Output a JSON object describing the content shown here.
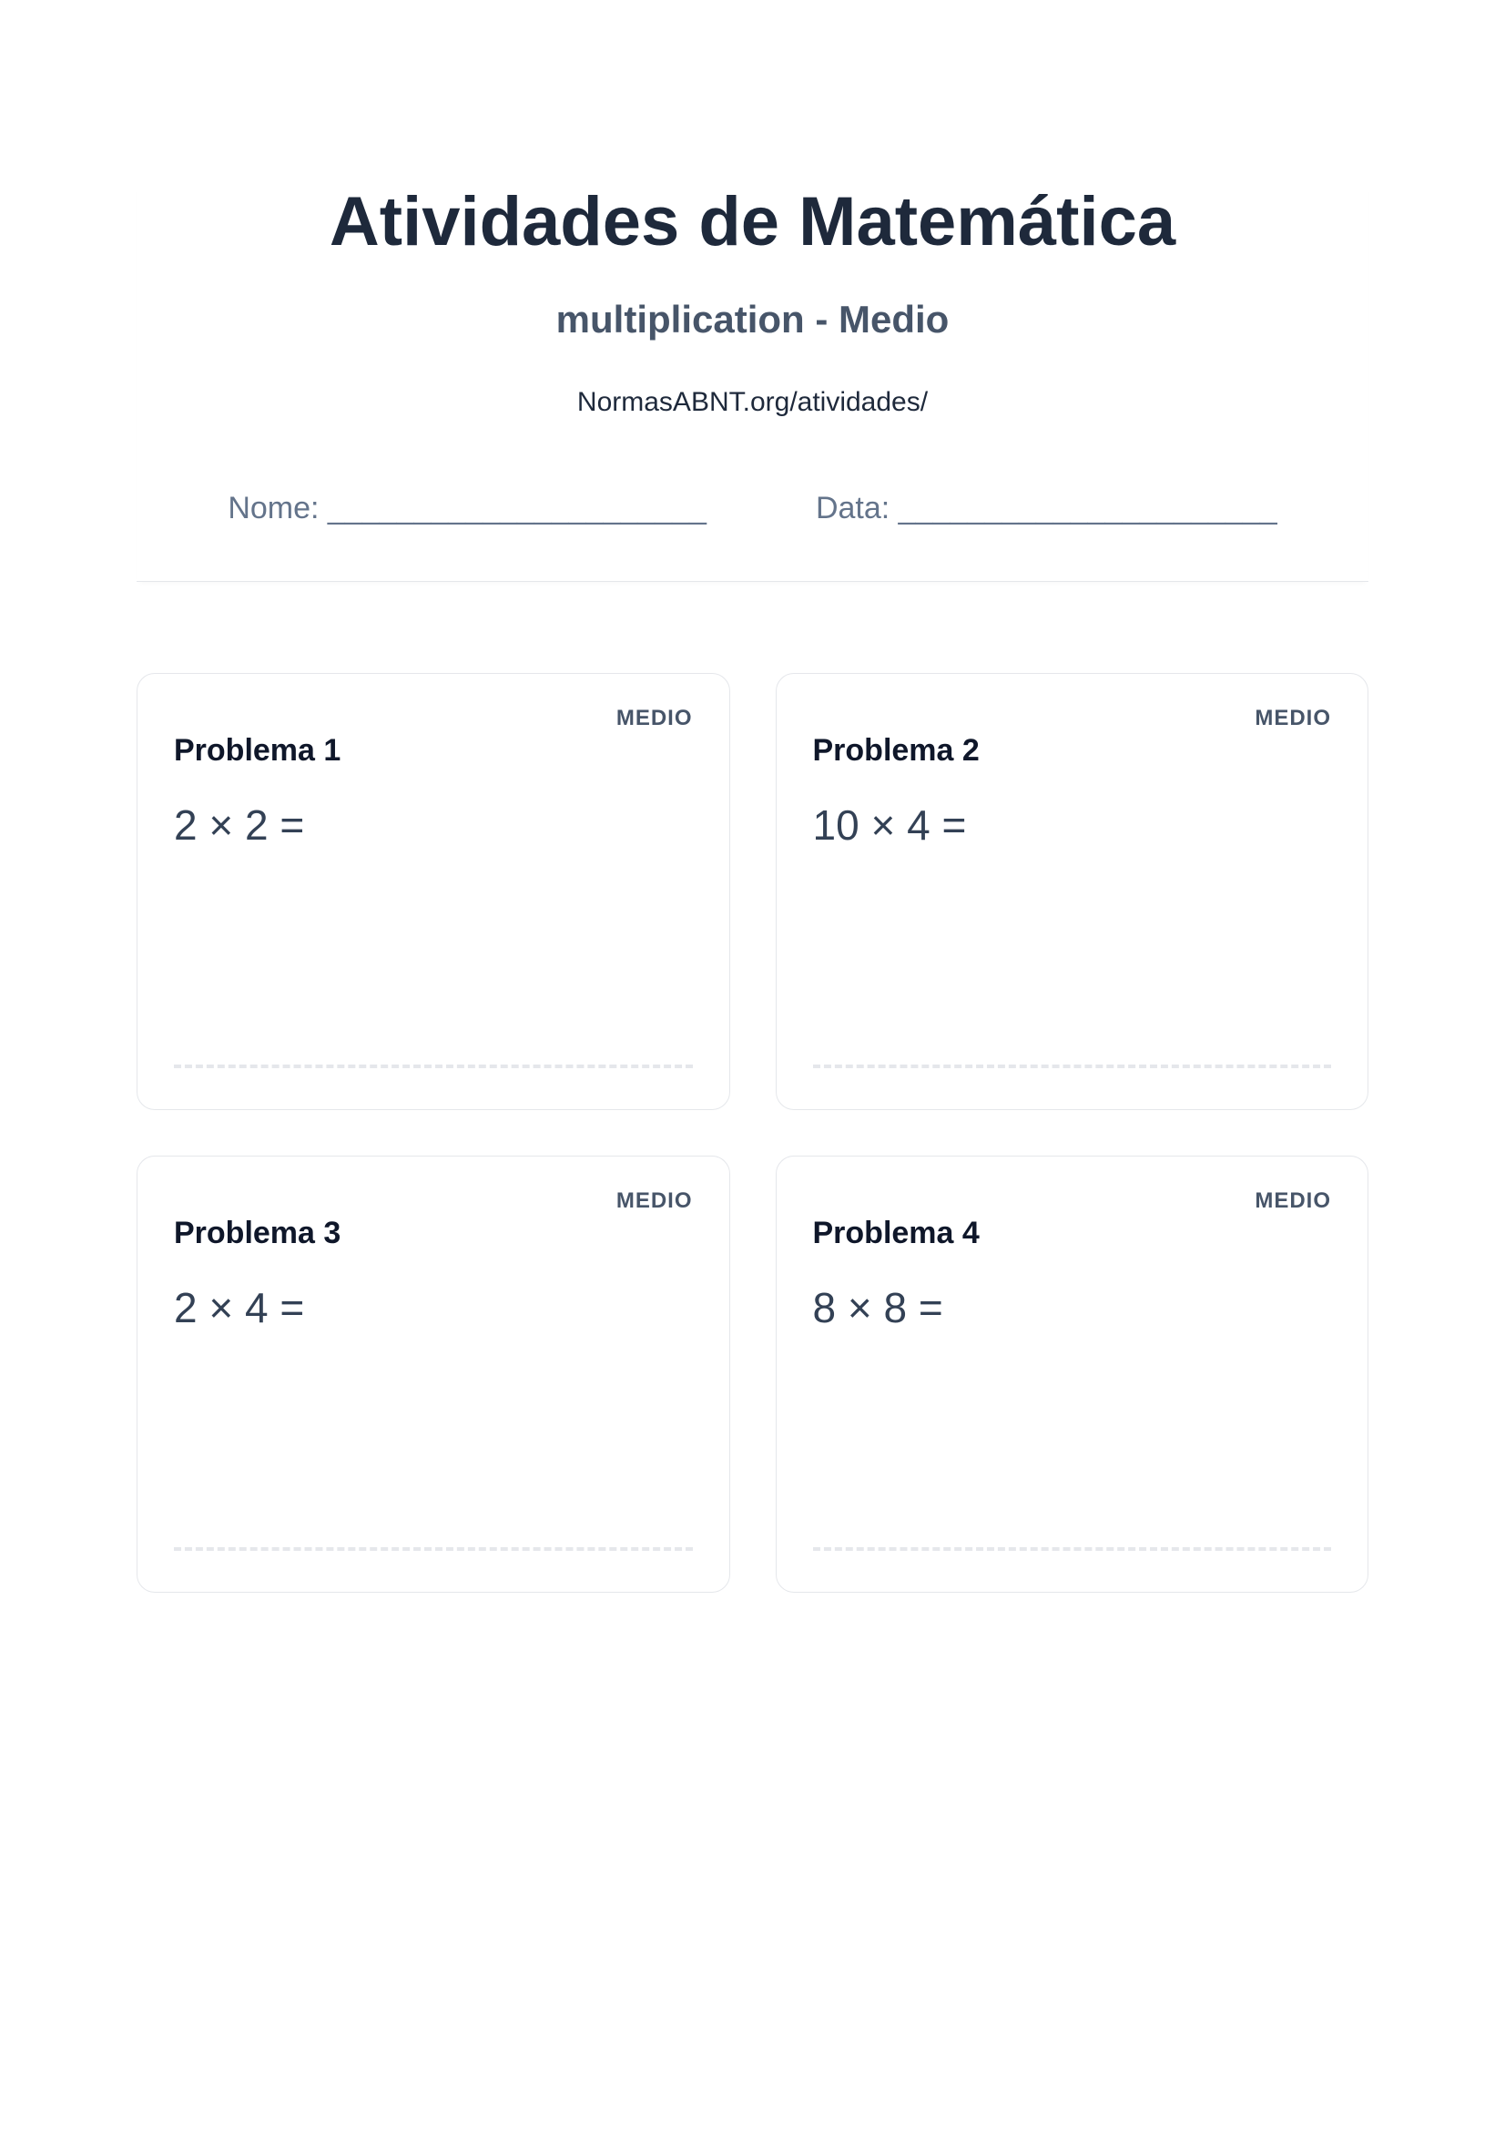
{
  "header": {
    "title": "Atividades de Matemática",
    "subtitle": "multiplication - Medio",
    "source": "NormasABNT.org/atividades/",
    "name_label": "Nome: ______________________",
    "date_label": "Data: ______________________"
  },
  "problems": [
    {
      "badge": "MEDIO",
      "title": "Problema 1",
      "expression": "2 × 2 ="
    },
    {
      "badge": "MEDIO",
      "title": "Problema 2",
      "expression": "10 × 4 ="
    },
    {
      "badge": "MEDIO",
      "title": "Problema 3",
      "expression": "2 × 4 ="
    },
    {
      "badge": "MEDIO",
      "title": "Problema 4",
      "expression": "8 × 8 ="
    }
  ]
}
